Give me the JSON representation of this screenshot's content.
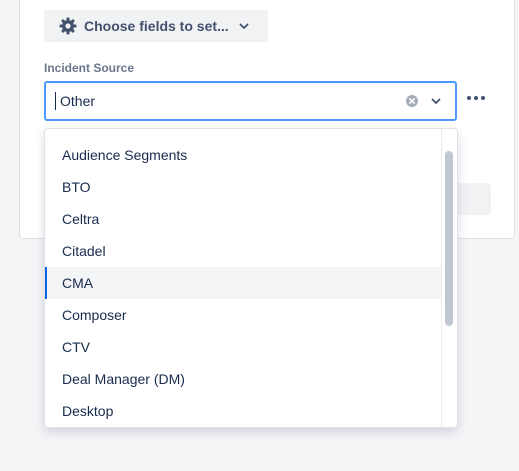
{
  "toolbar": {
    "choose_fields_label": "Choose fields to set...",
    "gear_icon": "gear-icon",
    "chevron_icon": "chevron-down-icon"
  },
  "field": {
    "label": "Incident Source",
    "value": "Other",
    "clear_icon": "clear-icon",
    "dropdown_icon": "chevron-down-icon",
    "more_icon": "more-horizontal-icon"
  },
  "dropdown": {
    "items": [
      {
        "label": "Audience Segments"
      },
      {
        "label": "BTO"
      },
      {
        "label": "Celtra"
      },
      {
        "label": "Citadel"
      },
      {
        "label": "CMA"
      },
      {
        "label": "Composer"
      },
      {
        "label": "CTV"
      },
      {
        "label": "Deal Manager (DM)"
      },
      {
        "label": "Desktop"
      }
    ],
    "highlighted_label": "CMA"
  },
  "colors": {
    "focus_border": "#4c9aff",
    "highlight_bar": "#0c66e4",
    "text": "#172b4d",
    "label": "#6b778c"
  }
}
